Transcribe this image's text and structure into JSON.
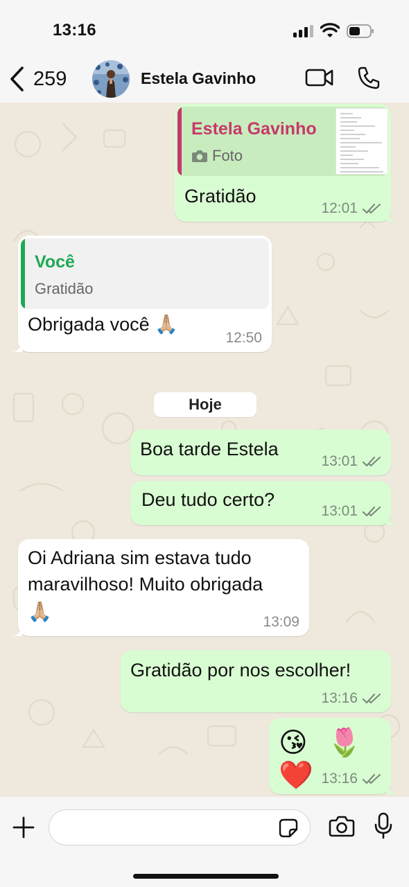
{
  "status_bar": {
    "time": "13:16"
  },
  "header": {
    "back_count": "259",
    "contact_name": "Estela Gavinho"
  },
  "messages": [
    {
      "direction": "outgoing",
      "quote": {
        "author": "Estela Gavinho",
        "text": "Foto",
        "author_color": "#c6386a"
      },
      "text": "Gratidão",
      "time": "12:01",
      "status": "read"
    },
    {
      "direction": "incoming",
      "quote": {
        "author": "Você",
        "text": "Gratidão",
        "author_color": "#1fa855"
      },
      "text": "Obrigada você 🙏🏼",
      "time": "12:50"
    },
    {
      "direction": "outgoing",
      "text": "Boa tarde Estela",
      "time": "13:01",
      "status": "read"
    },
    {
      "direction": "outgoing",
      "text": "Deu tudo certo?",
      "time": "13:01",
      "status": "read"
    },
    {
      "direction": "incoming",
      "text_lines": [
        "Oi Adriana sim estava tudo",
        "maravilhoso! Muito obrigada",
        "🙏🏼"
      ],
      "time": "13:09"
    },
    {
      "direction": "outgoing",
      "text": "Gratidão por nos escolher!",
      "time": "13:16",
      "status": "read"
    },
    {
      "direction": "outgoing",
      "text": "😘 🌷 ❤️",
      "time": "13:16",
      "status": "read"
    }
  ],
  "day_separator": "Hoje",
  "composer": {
    "placeholder": ""
  },
  "colors": {
    "outgoing_bubble": "#d9fdd3",
    "incoming_bubble": "#ffffff",
    "read_ticks": "#7b8a7b",
    "accent_you": "#1fa855",
    "accent_contact": "#c6386a"
  },
  "icons": [
    "back-chevron-icon",
    "video-call-icon",
    "phone-call-icon",
    "camera-icon",
    "plus-icon",
    "sticker-icon",
    "microphone-icon",
    "double-check-icon"
  ]
}
